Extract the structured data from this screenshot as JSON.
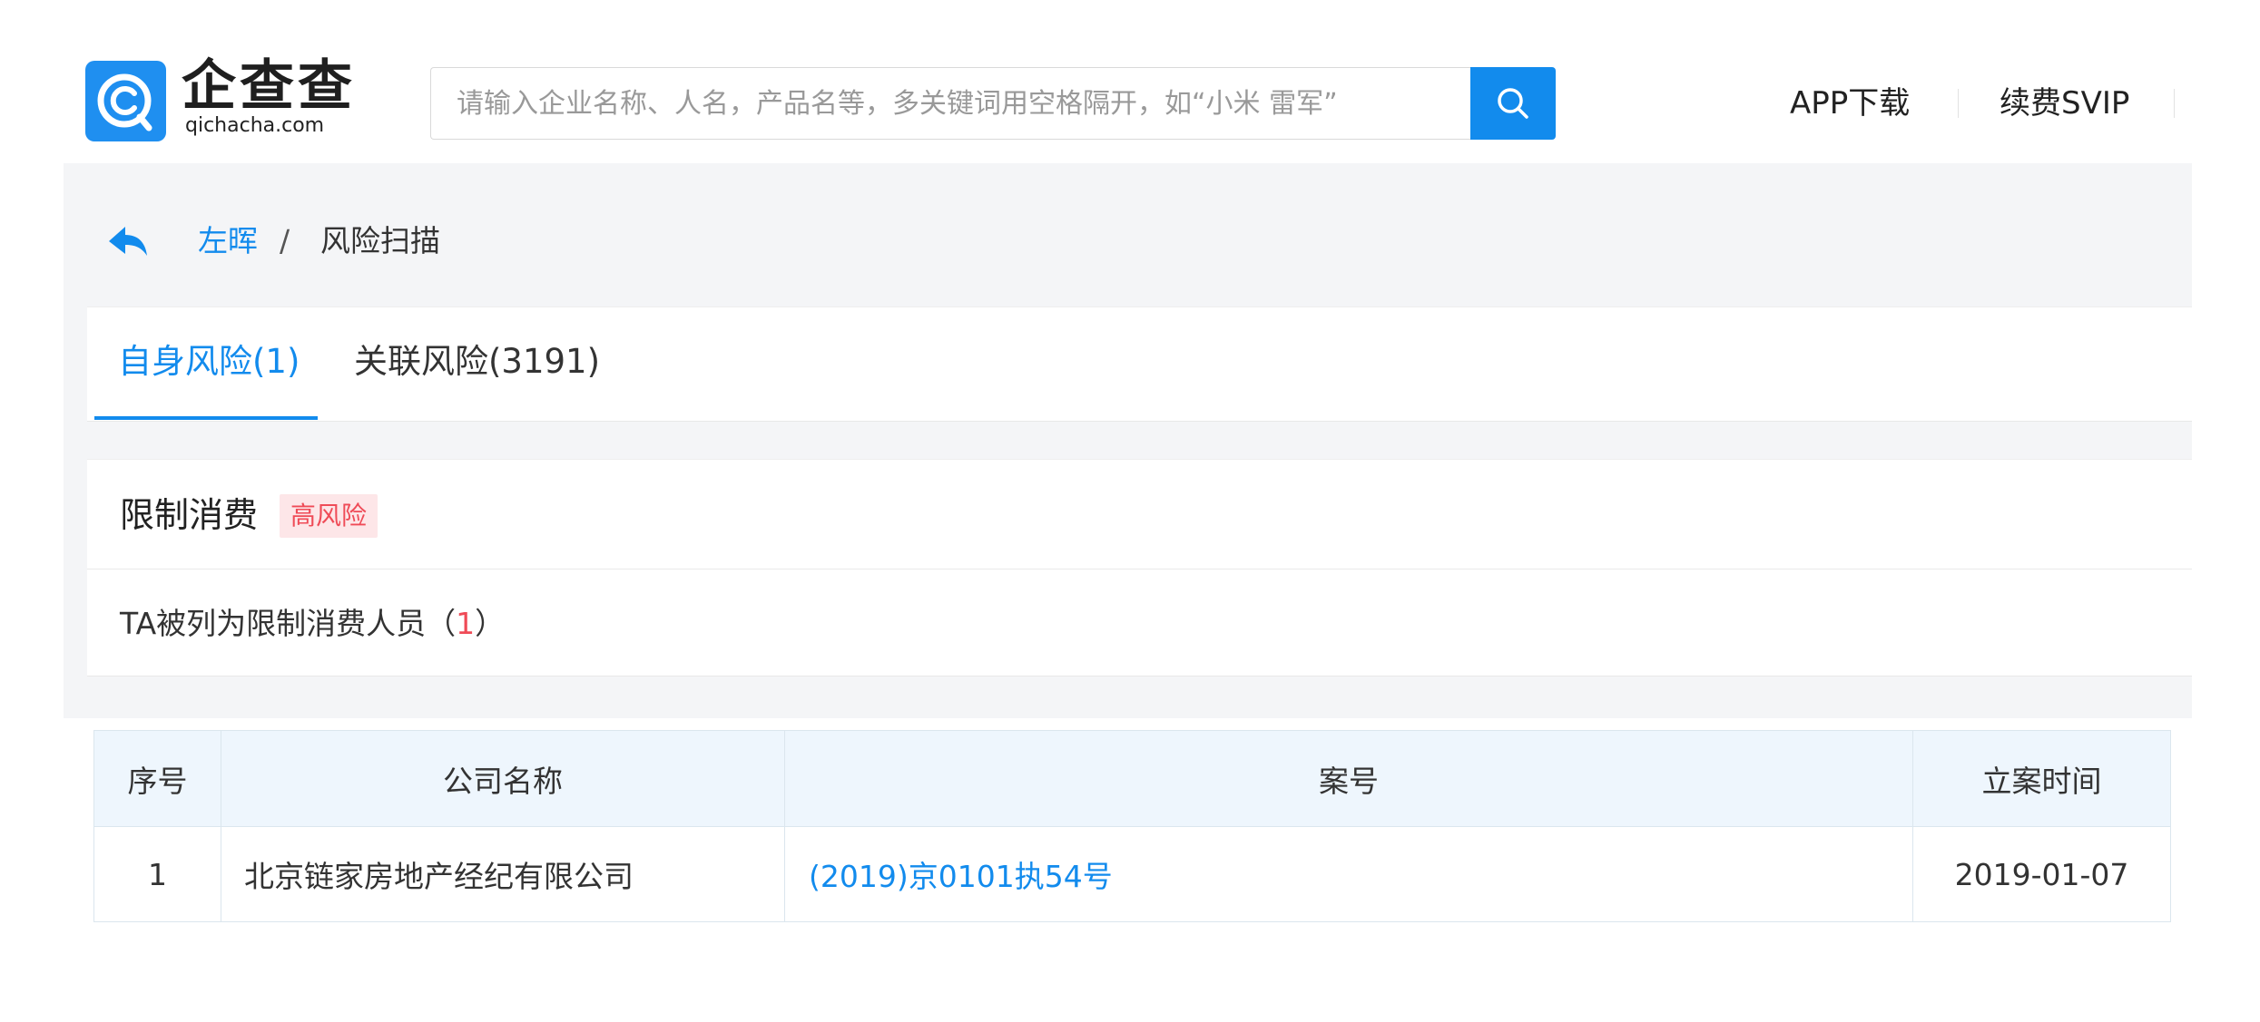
{
  "header": {
    "logo_cn": "企查查",
    "logo_en": "qichacha.com",
    "search_placeholder": "请输入企业名称、人名，产品名等，多关键词用空格隔开，如“小米 雷军”",
    "nav": [
      "APP下载",
      "续费SVIP"
    ]
  },
  "breadcrumb": {
    "back_label": "左晖",
    "separator": "/",
    "current": "风险扫描"
  },
  "tabs": [
    {
      "label": "自身风险(1)",
      "active": true
    },
    {
      "label": "关联风险(3191)",
      "active": false
    }
  ],
  "risk_section": {
    "title": "限制消费",
    "badge": "高风险",
    "subtitle_prefix": "TA被列为限制消费人员（",
    "subtitle_count": "1",
    "subtitle_suffix": "）"
  },
  "table": {
    "columns": [
      "序号",
      "公司名称",
      "案号",
      "立案时间"
    ],
    "rows": [
      [
        "1",
        "北京链家房地产经纪有限公司",
        "(2019)京0101执54号",
        "2019-01-07"
      ]
    ]
  },
  "colors": {
    "brand_blue": "#128bed",
    "risk_red": "#ef4b57",
    "panel_grey": "#f4f5f7"
  }
}
